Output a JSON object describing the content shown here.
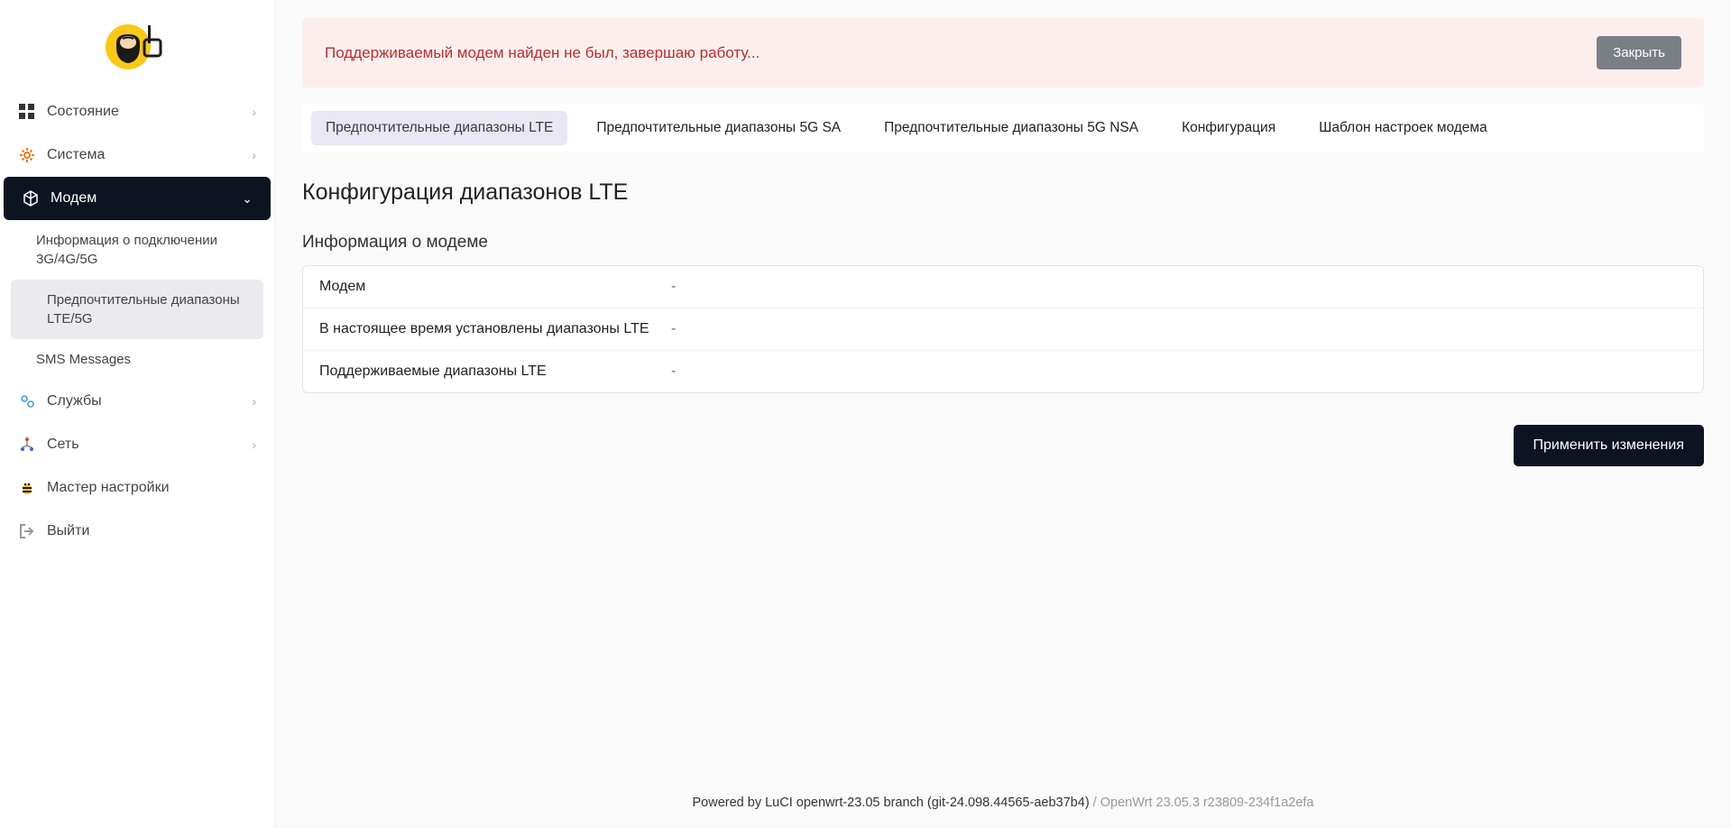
{
  "sidebar": {
    "items": [
      {
        "label": "Состояние",
        "icon": "dashboard",
        "expandable": true
      },
      {
        "label": "Система",
        "icon": "gear",
        "expandable": true
      },
      {
        "label": "Модем",
        "icon": "cube",
        "expandable": true,
        "active": true
      },
      {
        "label": "Службы",
        "icon": "gears",
        "expandable": true
      },
      {
        "label": "Сеть",
        "icon": "network",
        "expandable": true
      },
      {
        "label": "Мастер настройки",
        "icon": "bee"
      },
      {
        "label": "Выйти",
        "icon": "logout"
      }
    ],
    "modem_sub": [
      {
        "label": "Информация о подключении 3G/4G/5G"
      },
      {
        "label": "Предпочтительные диапазоны LTE/5G",
        "selected": true
      },
      {
        "label": "SMS Messages"
      }
    ]
  },
  "alert": {
    "text": "Поддерживаемый модем найден не был, завершаю работу...",
    "close": "Закрыть"
  },
  "tabs": [
    {
      "label": "Предпочтительные диапазоны LTE",
      "active": true
    },
    {
      "label": "Предпочтительные диапазоны 5G SA"
    },
    {
      "label": "Предпочтительные диапазоны 5G NSA"
    },
    {
      "label": "Конфигурация"
    },
    {
      "label": "Шаблон настроек модема"
    }
  ],
  "page": {
    "title": "Конфигурация диапазонов LTE",
    "section_title": "Информация о модеме",
    "rows": [
      {
        "label": "Модем",
        "value": "-"
      },
      {
        "label": "В настоящее время установлены диапазоны LTE",
        "value": "-"
      },
      {
        "label": "Поддерживаемые диапазоны LTE",
        "value": "-"
      }
    ],
    "apply": "Применить изменения"
  },
  "footer": {
    "powered": "Powered by LuCI openwrt-23.05 branch (git-24.098.44565-aeb37b4)",
    "version": " / OpenWrt 23.05.3 r23809-234f1a2efa"
  }
}
